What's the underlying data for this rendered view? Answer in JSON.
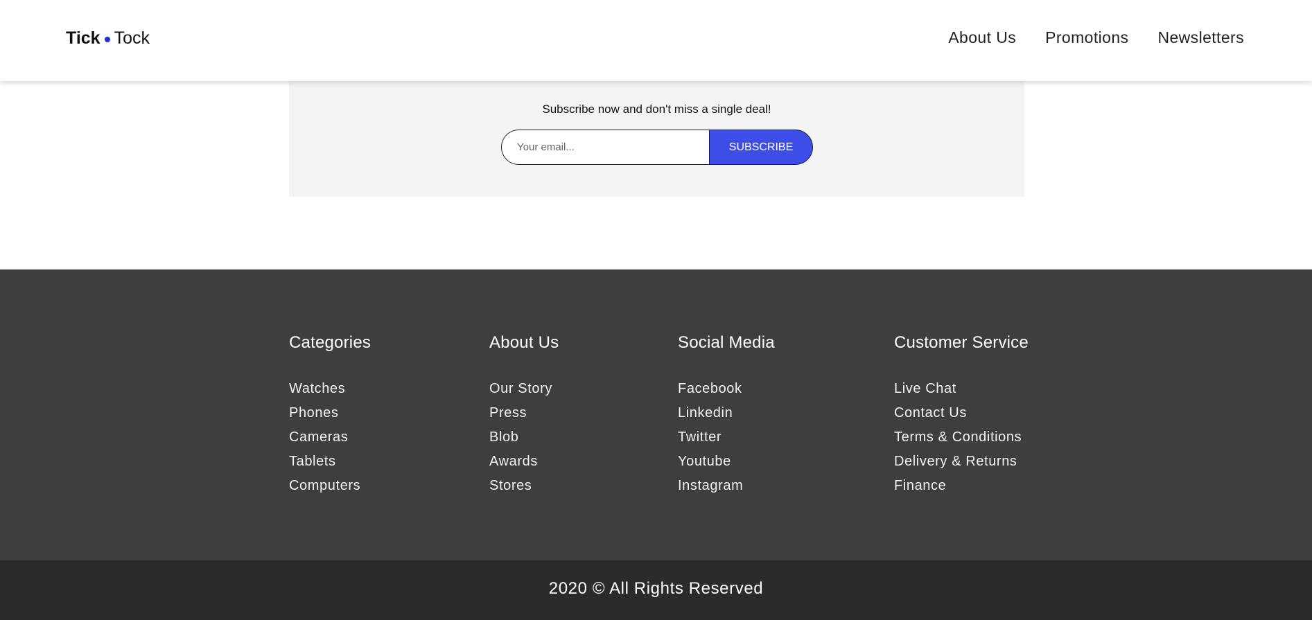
{
  "header": {
    "logo_part1": "Tick",
    "logo_part2": "Tock",
    "logo_dot_color": "#1f2bdb",
    "nav": [
      {
        "label": "About Us"
      },
      {
        "label": "Promotions"
      },
      {
        "label": "Newsletters"
      }
    ]
  },
  "subscribe": {
    "text": "Subscribe now and don't miss a single deal!",
    "email_placeholder": "Your email...",
    "email_value": "",
    "button_label": "SUBSCRIBE",
    "button_color": "#3d4ee8"
  },
  "footer": {
    "background": "#3e3e3e",
    "columns": [
      {
        "heading": "Categories",
        "links": [
          "Watches",
          "Phones",
          "Cameras",
          "Tablets",
          "Computers"
        ]
      },
      {
        "heading": "About Us",
        "links": [
          "Our Story",
          "Press",
          "Blob",
          "Awards",
          "Stores"
        ]
      },
      {
        "heading": "Social Media",
        "links": [
          "Facebook",
          "Linkedin",
          "Twitter",
          "Youtube",
          "Instagram"
        ]
      },
      {
        "heading": "Customer Service",
        "links": [
          "Live Chat",
          "Contact Us",
          "Terms & Conditions",
          "Delivery & Returns",
          "Finance"
        ]
      }
    ],
    "copyright": "2020 © All Rights Reserved"
  }
}
